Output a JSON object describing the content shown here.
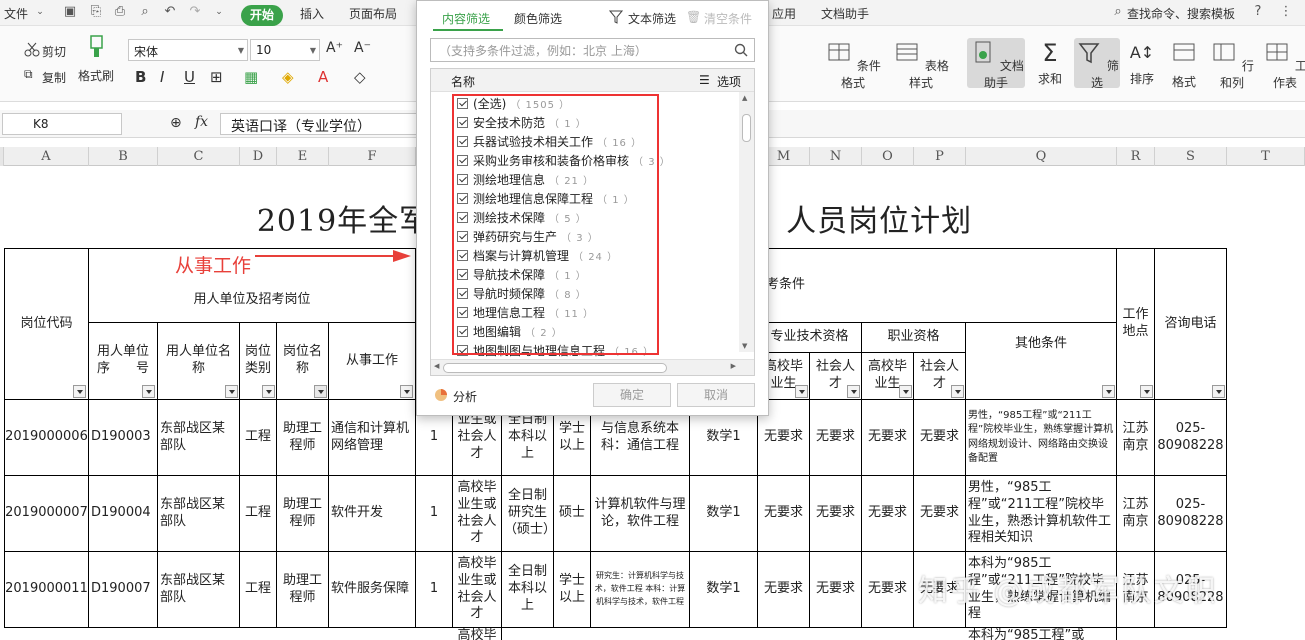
{
  "menu": {
    "file": "文件",
    "tabs": [
      "开始",
      "插入",
      "页面布局"
    ],
    "right_tabs": [
      "应用",
      "文档助手"
    ],
    "search": "查找命令、搜索模板"
  },
  "ribbon": {
    "cut": "剪切",
    "copy": "复制",
    "format_painter": "格式刷",
    "font_name": "宋体",
    "font_size": "10",
    "bold": "B",
    "italic": "I",
    "underline": "U",
    "conditional_format": "条件格式",
    "table_style": "表格样式",
    "doc_assistant": "文档助手",
    "sum": "求和",
    "filter": "筛选",
    "sort": "排序",
    "format": "格式",
    "row_col": "行和列",
    "worksheet": "工作表"
  },
  "formula_bar": {
    "cell_ref": "K8",
    "fx": "fx",
    "content": "英语口译（专业学位）"
  },
  "columns": [
    "A",
    "B",
    "C",
    "D",
    "E",
    "F",
    "M",
    "N",
    "O",
    "P",
    "Q",
    "R",
    "S",
    "T"
  ],
  "sheet": {
    "title_left": "2019年全军",
    "title_right": "人员岗位计划",
    "header_post_code": "岗位代码",
    "header_employer_group": "用人单位及招考岗位",
    "header_conditions_group": "考条件",
    "header_employer_no": "用人单位序　　号",
    "header_employer_name": "用人单位名　　称",
    "header_post_type": "岗位类别",
    "header_post_name": "岗位名称",
    "header_work": "从事工作",
    "header_tech_qual": "专业技术资格",
    "header_prof_qual": "职业资格",
    "header_grad": "高校毕业生",
    "header_social": "社会人才",
    "header_grad2": "高校毕业生",
    "header_social2": "社会人才",
    "header_other": "其他条件",
    "header_location": "工作地点",
    "header_phone": "咨询电话",
    "annotation": "从事工作",
    "rows": [
      {
        "code": "2019000006",
        "no": "D190003",
        "unit": "东部战区某部队",
        "type": "工程",
        "post": "助理工程师",
        "work": "通信和计算机网络管理",
        "num": "1",
        "source": "业生或社会人才",
        "edu": "全日制本科以上",
        "degree": "学士以上",
        "major": "与信息系统本科：通信工程",
        "exam": "数学1",
        "m": "无要求",
        "n": "无要求",
        "o": "无要求",
        "p": "无要求",
        "other": "男性，“985工程”或“211工程”院校毕业生，熟练掌握计算机网络规划设计、网络路由交换设备配置",
        "loc": "江苏南京",
        "phone": "025-80908228"
      },
      {
        "code": "2019000007",
        "no": "D190004",
        "unit": "东部战区某部队",
        "type": "工程",
        "post": "助理工程师",
        "work": "软件开发",
        "num": "1",
        "source": "高校毕业生或社会人才",
        "edu": "全日制研究生（硕士）",
        "degree": "硕士",
        "major": "计算机软件与理论，软件工程",
        "exam": "数学1",
        "m": "无要求",
        "n": "无要求",
        "o": "无要求",
        "p": "无要求",
        "other": "男性，“985工程”或“211工程”院校毕业生，熟悉计算机软件工程相关知识",
        "loc": "江苏南京",
        "phone": "025-80908228"
      },
      {
        "code": "2019000011",
        "no": "D190007",
        "unit": "东部战区某部队",
        "type": "工程",
        "post": "助理工程师",
        "work": "软件服务保障",
        "num": "1",
        "source": "高校毕业生或社会人才",
        "edu": "全日制本科以上",
        "degree": "学士以上",
        "major": "研究生：计算机科学与技术，软件工程 本科：计算机科学与技术，软件工程",
        "exam": "数学1",
        "m": "无要求",
        "n": "无要求",
        "o": "无要求",
        "p": "无要求",
        "other": "本科为“985工程”或“211工程”院校毕业生，熟练掌握计算机编程",
        "loc": "江苏南京",
        "phone": "025-80908228"
      }
    ],
    "row4_partial_source": "高校毕",
    "row4_partial_other": "本科为“985工程”或"
  },
  "filter_dialog": {
    "tab_content": "内容筛选",
    "tab_color": "颜色筛选",
    "text_filter": "文本筛选",
    "clear": "清空条件",
    "search_placeholder": "（支持多条件过滤，例如：北京  上海）",
    "list_header": "名称",
    "options": "选项",
    "items": [
      {
        "label": "(全选)",
        "count": "（ 1505 ）"
      },
      {
        "label": "安全技术防范",
        "count": "（ 1 ）"
      },
      {
        "label": "兵器试验技术相关工作",
        "count": "（ 16 ）"
      },
      {
        "label": "采购业务审核和装备价格审核",
        "count": "（ 3 ）"
      },
      {
        "label": "测绘地理信息",
        "count": "（ 21 ）"
      },
      {
        "label": "测绘地理信息保障工程",
        "count": "（ 1 ）"
      },
      {
        "label": "测绘技术保障",
        "count": "（ 5 ）"
      },
      {
        "label": "弹药研究与生产",
        "count": "（ 3 ）"
      },
      {
        "label": "档案与计算机管理",
        "count": "（ 24 ）"
      },
      {
        "label": "导航技术保障",
        "count": "（ 1 ）"
      },
      {
        "label": "导航时频保障",
        "count": "（ 8 ）"
      },
      {
        "label": "地理信息工程",
        "count": "（ 11 ）"
      },
      {
        "label": "地图编辑",
        "count": "（ 2 ）"
      },
      {
        "label": "地图制图与地理信息工程",
        "count": "（ 16 ）"
      }
    ],
    "analyze": "分析",
    "ok": "确定",
    "cancel": "取消"
  },
  "watermark": "知乎 @成都军队文职",
  "colors": {
    "accent": "#3aa24a",
    "annotation": "#e8403a"
  }
}
